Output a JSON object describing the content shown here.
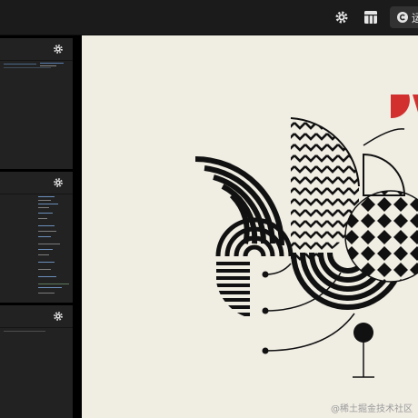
{
  "toolbar": {
    "settings_icon": "gear-icon",
    "layout_icon": "layout-grid-icon",
    "run_icon": "refresh-icon",
    "run_label": "运"
  },
  "editor_panels": [
    {
      "name": "html-panel",
      "icon": "gear-icon"
    },
    {
      "name": "css-panel",
      "icon": "gear-icon"
    },
    {
      "name": "js-panel",
      "icon": "gear-icon"
    }
  ],
  "watermark": "@稀土掘金技术社区",
  "colors": {
    "background": "#f0ede3",
    "ink": "#111111",
    "accent_red": "#d2302f",
    "editor_bg": "#222222",
    "topbar_bg": "#1b1b1b"
  }
}
